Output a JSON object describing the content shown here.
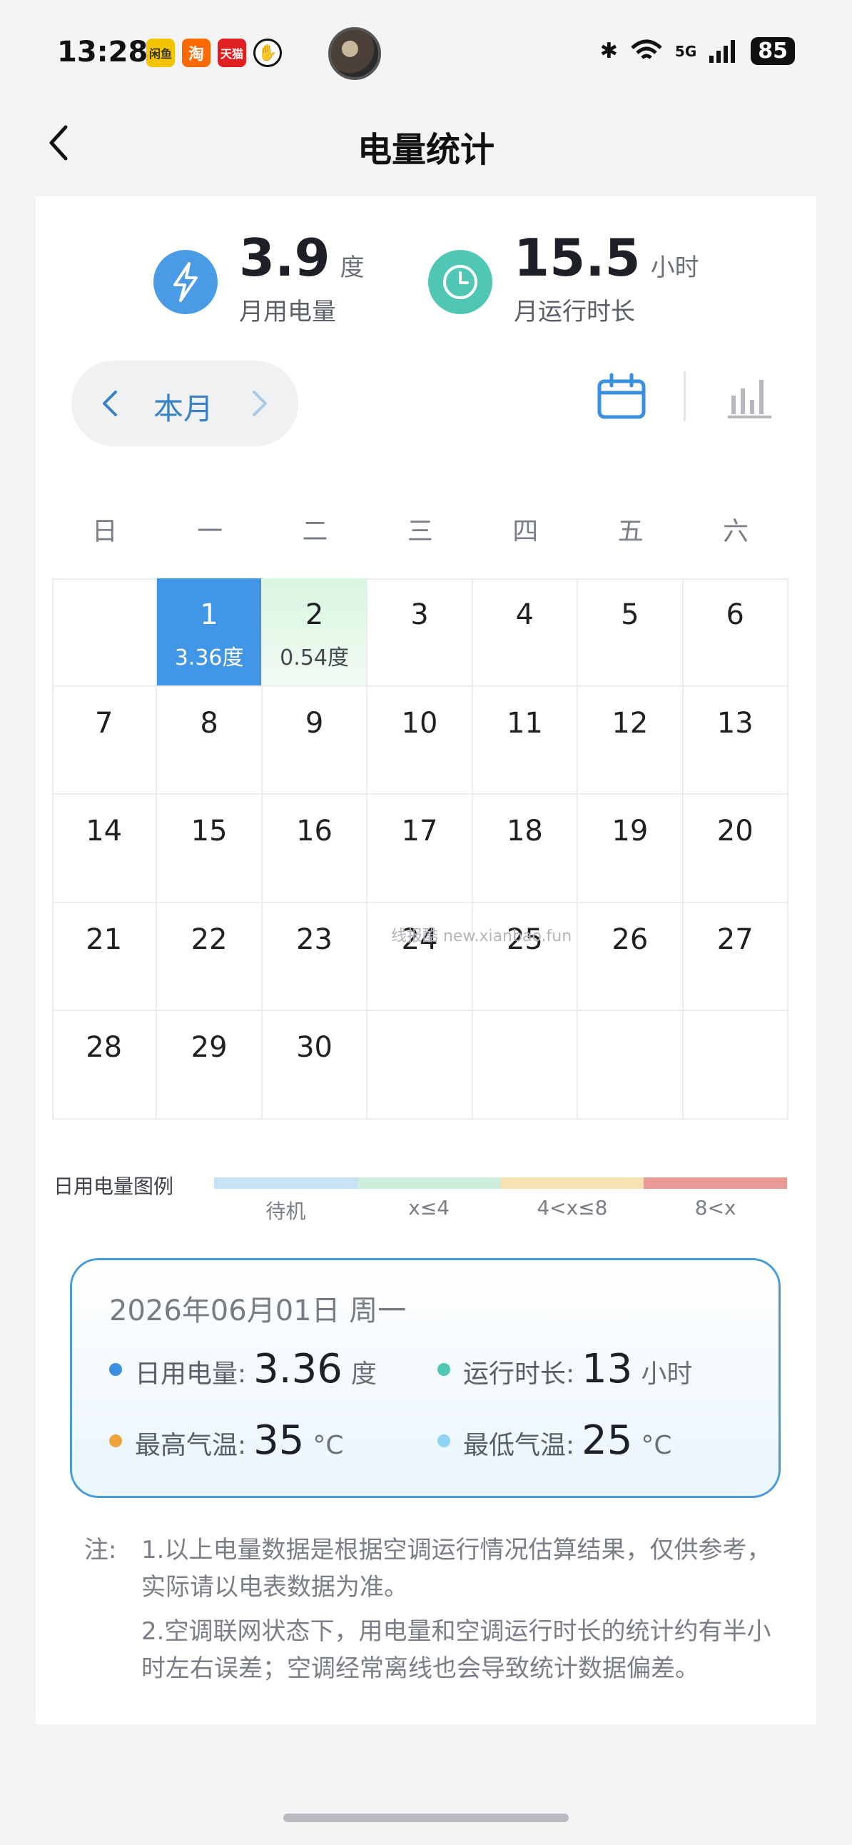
{
  "status_bar": {
    "time": "13:28",
    "battery": "85",
    "network": "5G",
    "app_icons": [
      {
        "name": "app-icon-1",
        "label": "闲鱼",
        "color": "#f5c400"
      },
      {
        "name": "app-icon-2",
        "label": "淘",
        "color": "#ff6a00"
      },
      {
        "name": "app-icon-3",
        "label": "天猫",
        "color": "#e02020"
      },
      {
        "name": "app-icon-4",
        "label": "✋",
        "color": "#ffffff"
      }
    ]
  },
  "header": {
    "title": "电量统计"
  },
  "summary": {
    "energy_value": "3.9",
    "energy_unit": "度",
    "energy_label": "月用电量",
    "runtime_value": "15.5",
    "runtime_unit": "小时",
    "runtime_label": "月运行时长",
    "colors": {
      "energy": "#4a9be6",
      "runtime": "#4fc7b4"
    }
  },
  "month_selector": {
    "label": "本月"
  },
  "calendar": {
    "weekdays": [
      "日",
      "一",
      "二",
      "三",
      "四",
      "五",
      "六"
    ],
    "days": [
      {
        "day": "",
        "value": "",
        "state": "empty"
      },
      {
        "day": "1",
        "value": "3.36度",
        "state": "selected"
      },
      {
        "day": "2",
        "value": "0.54度",
        "state": "low"
      },
      {
        "day": "3",
        "value": "",
        "state": ""
      },
      {
        "day": "4",
        "value": "",
        "state": ""
      },
      {
        "day": "5",
        "value": "",
        "state": ""
      },
      {
        "day": "6",
        "value": "",
        "state": ""
      },
      {
        "day": "7",
        "value": "",
        "state": ""
      },
      {
        "day": "8",
        "value": "",
        "state": ""
      },
      {
        "day": "9",
        "value": "",
        "state": ""
      },
      {
        "day": "10",
        "value": "",
        "state": ""
      },
      {
        "day": "11",
        "value": "",
        "state": ""
      },
      {
        "day": "12",
        "value": "",
        "state": ""
      },
      {
        "day": "13",
        "value": "",
        "state": ""
      },
      {
        "day": "14",
        "value": "",
        "state": ""
      },
      {
        "day": "15",
        "value": "",
        "state": ""
      },
      {
        "day": "16",
        "value": "",
        "state": ""
      },
      {
        "day": "17",
        "value": "",
        "state": ""
      },
      {
        "day": "18",
        "value": "",
        "state": ""
      },
      {
        "day": "19",
        "value": "",
        "state": ""
      },
      {
        "day": "20",
        "value": "",
        "state": ""
      },
      {
        "day": "21",
        "value": "",
        "state": ""
      },
      {
        "day": "22",
        "value": "",
        "state": ""
      },
      {
        "day": "23",
        "value": "",
        "state": ""
      },
      {
        "day": "24",
        "value": "",
        "state": ""
      },
      {
        "day": "25",
        "value": "",
        "state": ""
      },
      {
        "day": "26",
        "value": "",
        "state": ""
      },
      {
        "day": "27",
        "value": "",
        "state": ""
      },
      {
        "day": "28",
        "value": "",
        "state": ""
      },
      {
        "day": "29",
        "value": "",
        "state": ""
      },
      {
        "day": "30",
        "value": "",
        "state": ""
      },
      {
        "day": "",
        "value": "",
        "state": "empty"
      },
      {
        "day": "",
        "value": "",
        "state": "empty"
      },
      {
        "day": "",
        "value": "",
        "state": "empty"
      },
      {
        "day": "",
        "value": "",
        "state": "empty"
      }
    ],
    "watermark": "线报酷 new.xianbao.fun"
  },
  "legend": {
    "title": "日用电量图例",
    "items": [
      {
        "label": "待机",
        "color": "#c6e2f3"
      },
      {
        "label": "x≤4",
        "color": "#cdeedb"
      },
      {
        "label": "4<x≤8",
        "color": "#f8e2b2"
      },
      {
        "label": "8<x",
        "color": "#ea9a94"
      }
    ]
  },
  "detail": {
    "date": "2026年06月01日  周一",
    "energy": {
      "label": "日用电量:",
      "value": "3.36",
      "unit": "度",
      "color": "#3b8fe0"
    },
    "runtime": {
      "label": "运行时长:",
      "value": "13",
      "unit": "小时",
      "color": "#4fc7b4"
    },
    "max_temp": {
      "label": "最高气温:",
      "value": "35",
      "unit": "°C",
      "color": "#f0a33c"
    },
    "min_temp": {
      "label": "最低气温:",
      "value": "25",
      "unit": "°C",
      "color": "#8fd3f3"
    }
  },
  "notes": {
    "lead": "注:",
    "items": [
      "1.以上电量数据是根据空调运行情况估算结果，仅供参考，实际请以电表数据为准。",
      "2.空调联网状态下，用电量和空调运行时长的统计约有半小时左右误差；空调经常离线也会导致统计数据偏差。"
    ]
  }
}
